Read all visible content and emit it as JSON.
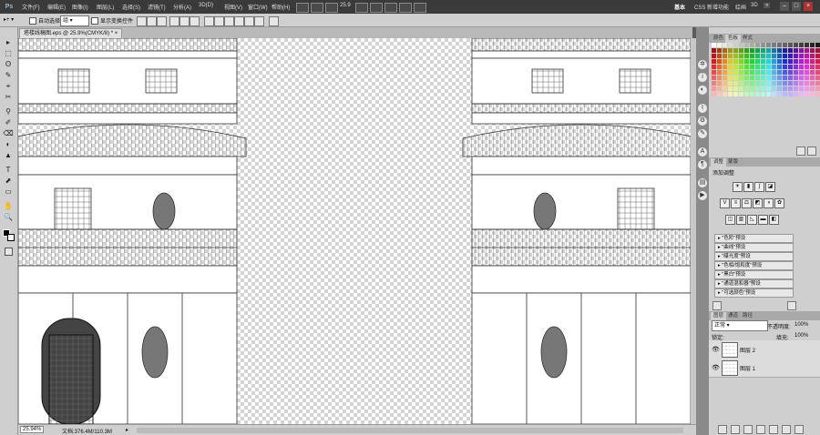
{
  "app": {
    "logo": "Ps"
  },
  "menu": [
    "文件(F)",
    "编辑(E)",
    "图像(I)",
    "图层(L)",
    "选择(S)",
    "滤镜(T)",
    "分析(A)",
    "3D(D)",
    "视图(V)",
    "窗口(W)",
    "帮助(H)"
  ],
  "menubar": {
    "zoom": "25.9"
  },
  "workspaces": [
    "基本",
    "CSS 新增功能",
    "绘画",
    "3D",
    "更多"
  ],
  "workspace_active": "基本",
  "window_buttons": [
    "–",
    "□",
    "×"
  ],
  "options": {
    "auto_select_label": "自动选择:",
    "auto_select_value": "组",
    "transform_label": "显示变换控件"
  },
  "tools": [
    "▸",
    "⬚",
    "ʘ",
    "✎",
    "⌖",
    "✂",
    "⚲",
    "✐",
    "⌫",
    "◐",
    "▲",
    "T",
    "⬈",
    "▭",
    "✋",
    "🔍"
  ],
  "document": {
    "tab_title": "塔楼线稿图.eps @ 25.9%(CMYK/8) *",
    "tab_close": "×"
  },
  "status": {
    "zoom": "25.94%",
    "doc_size": "文档:376.4M/110.3M"
  },
  "panels": {
    "swatch_tabs": [
      "颜色",
      "色板",
      "样式"
    ],
    "swatch_active": "色板",
    "adjust_tabs": [
      "调整",
      "蒙版"
    ],
    "adjust_title": "添加调整",
    "presets": [
      "\"色阶\"预设",
      "\"曲线\"预设",
      "\"曝光度\"预设",
      "\"色相/饱和度\"预设",
      "\"黑白\"预设",
      "\"通道混和器\"预设",
      "\"可选颜色\"预设"
    ],
    "layer_tabs": [
      "图层",
      "通道",
      "路径"
    ],
    "blend_mode": "正常",
    "opacity_label": "不透明度:",
    "opacity_value": "100%",
    "lock_label": "锁定:",
    "fill_label": "填充:",
    "fill_value": "100%",
    "layers": [
      {
        "name": "图层 2",
        "visible": true
      },
      {
        "name": "图层 1",
        "visible": true
      }
    ]
  }
}
